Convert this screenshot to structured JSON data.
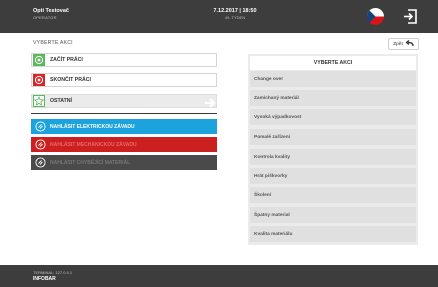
{
  "header": {
    "user_name": "Opti Testovač",
    "user_role": "OPERATOR",
    "datetime": "7.12.2017 | 18:50",
    "week": "49. TÝDEN",
    "flag_icon": "czech-flag-icon",
    "logout_icon": "logout-icon"
  },
  "section_title": "VYBERTE AKCI",
  "back_button": {
    "label": "Zpět",
    "icon": "back-arrow-icon"
  },
  "actions": [
    {
      "label": "ZAČÍT PRÁCI",
      "icon": "start-icon",
      "color": "#5cb85c"
    },
    {
      "label": "SKONČIT PRÁCI",
      "icon": "stop-icon",
      "color": "#d9252a"
    },
    {
      "label": "OSTATNÍ",
      "icon": "star-icon",
      "color": "#5cb85c"
    }
  ],
  "reports": [
    {
      "label": "NAHLÁSIT ELEKTRICKOU ZÁVADU",
      "icon": "electric-icon",
      "bg": "#1ca3dd",
      "fg": "#ffffff"
    },
    {
      "label": "NAHLÁSIT MECHANICKOU ZÁVADU",
      "icon": "mechanical-icon",
      "bg": "#cc1f1f",
      "fg": "#e86a6a"
    },
    {
      "label": "NAHLÁSIT CHYBĚJÍCÍ MATERIÁL",
      "icon": "material-icon",
      "bg": "#4a4a4a",
      "fg": "#777777"
    }
  ],
  "panel": {
    "title": "VYBERTE AKCI",
    "options": [
      "Change over",
      "Zamíchaný materiál",
      "Vysoká výpadkovost",
      "Pomalé zařízení",
      "Kontrola kvality",
      "Hrát piškvorky",
      "Školení",
      "Špatny material",
      "Kvalita materiálu"
    ]
  },
  "footer": {
    "terminal": "TERMINAL: 127.0.0.1",
    "app": "INFOBAR"
  },
  "colors": {
    "header_bg": "#3d3d3d",
    "accent_green": "#5cb85c",
    "accent_red": "#d9252a",
    "accent_blue": "#1ca3dd"
  }
}
